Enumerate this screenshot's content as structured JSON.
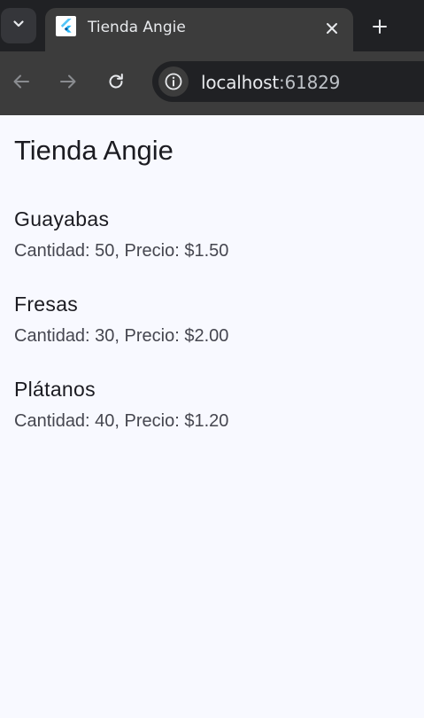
{
  "browser": {
    "tab": {
      "title": "Tienda Angie",
      "favicon": "flutter-logo-icon",
      "close_icon": "close-icon"
    },
    "new_tab_icon": "plus-icon",
    "tab_dropdown_icon": "chevron-down-icon",
    "toolbar": {
      "back_icon": "back-arrow-icon",
      "forward_icon": "forward-arrow-icon",
      "reload_icon": "reload-icon",
      "site_info_icon": "info-icon",
      "url_host": "localhost",
      "url_port": ":61829"
    }
  },
  "app": {
    "title": "Tienda Angie",
    "products": [
      {
        "name": "Guayabas",
        "detail": "Cantidad: 50, Precio: $1.50"
      },
      {
        "name": "Fresas",
        "detail": "Cantidad: 30, Precio: $2.00"
      },
      {
        "name": "Plátanos",
        "detail": "Cantidad: 40, Precio: $1.20"
      }
    ]
  },
  "colors": {
    "chrome_dark": "#202124",
    "chrome_toolbar": "#3c3c3c",
    "page_background": "#f8f9ff",
    "text_primary": "#1b1b21",
    "text_secondary": "#45464f"
  }
}
